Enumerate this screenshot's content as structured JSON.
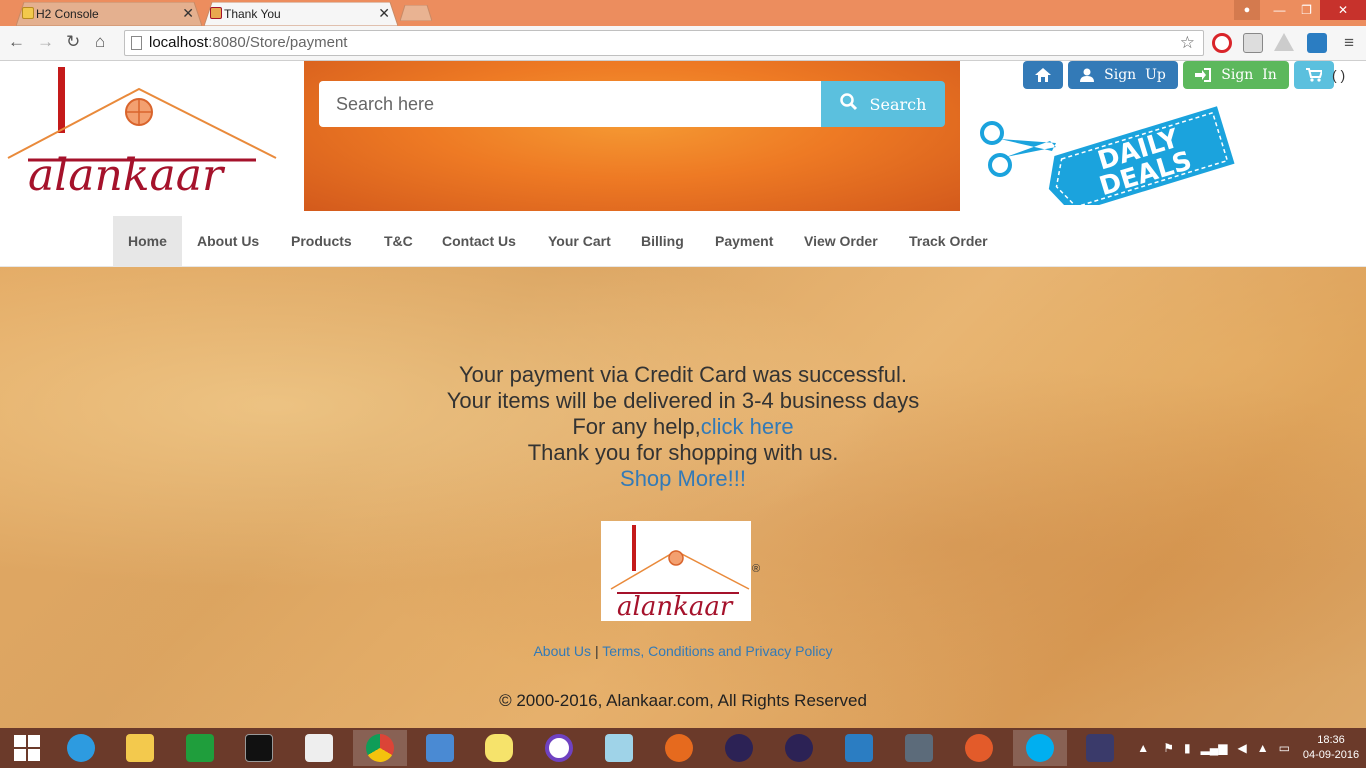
{
  "browser": {
    "tabs": [
      {
        "title": "H2 Console",
        "active": false
      },
      {
        "title": "Thank You",
        "active": true
      }
    ],
    "address": {
      "host": "localhost",
      "path": ":8080/Store/payment"
    }
  },
  "header": {
    "logo_text": "alankaar",
    "search": {
      "placeholder": "Search here",
      "button_label": "Search"
    },
    "top_buttons": {
      "signup": "Sign  Up",
      "signin": "Sign  In",
      "cart_count": "( )"
    },
    "deals_text": [
      "DAILY",
      "DEALS"
    ]
  },
  "nav": {
    "items": [
      "Home",
      "About Us",
      "Products",
      "T&C",
      "Contact Us",
      "Your Cart",
      "Billing",
      "Payment",
      "View Order",
      "Track Order"
    ],
    "active": "Home"
  },
  "message": {
    "line1": "Your payment via Credit Card was successful.",
    "line2": "Your items will be delivered in 3-4 business days",
    "line3_prefix": "For any help,",
    "line3_link": "click here",
    "line4": "Thank you for shopping with us.",
    "shop_more": "Shop More!!!"
  },
  "footer": {
    "registered": "®",
    "about": "About Us",
    "separator": "|",
    "terms": "Terms, Conditions and Privacy Policy",
    "copyright": "© 2000-2016, Alankaar.com, All Rights Reserved"
  },
  "taskbar": {
    "time": "18:36",
    "date": "04-09-2016"
  },
  "colors": {
    "primary": "#337ab7",
    "success": "#5cb85c",
    "info": "#5bc0de",
    "brand_red": "#a5122b",
    "tab_strip": "#ec8d5e",
    "taskbar": "#6b3a2a"
  }
}
